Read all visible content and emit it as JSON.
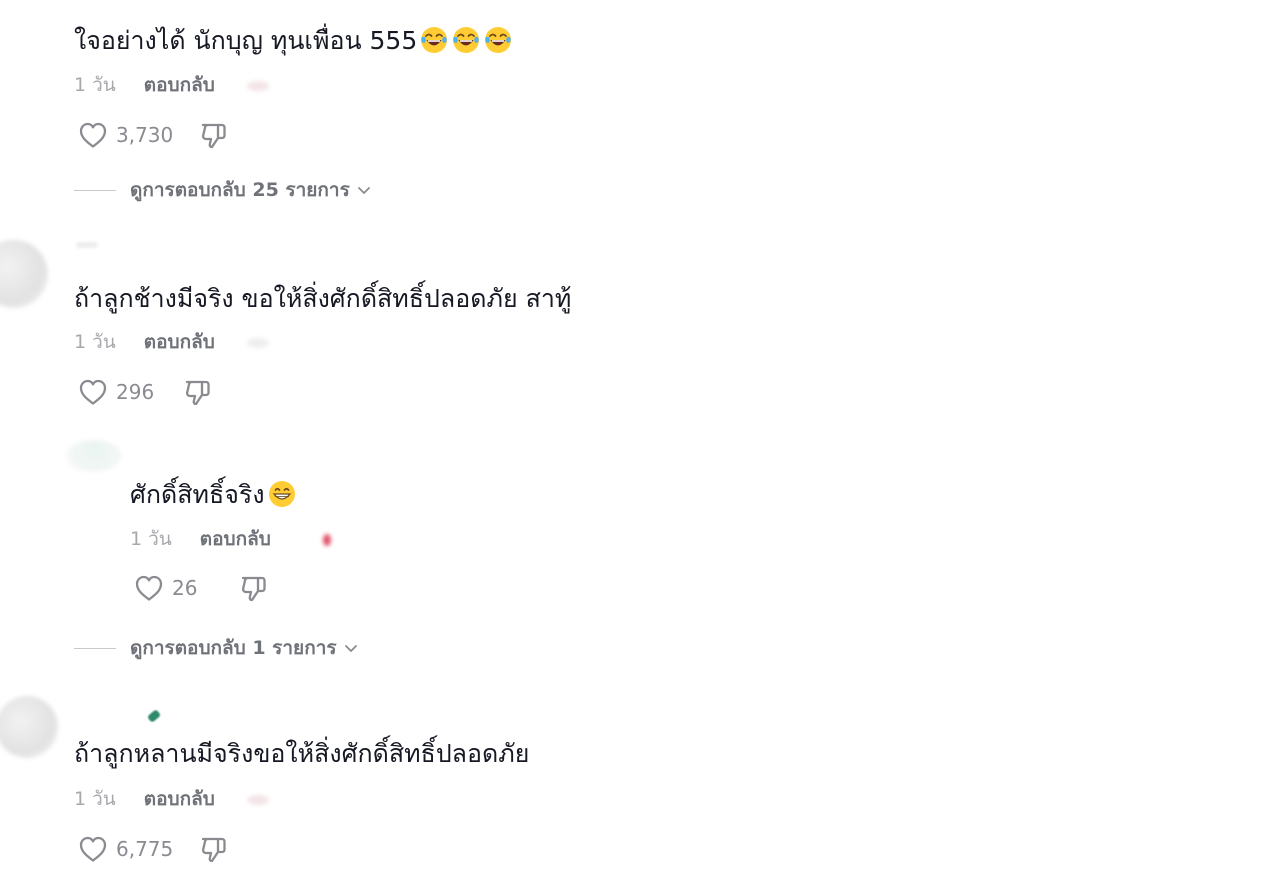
{
  "comments": [
    {
      "text": "ใจอย่างได้ นักบุญ ทุนเพื่อน 555",
      "emoji": [
        "face-with-tears-of-joy",
        "face-with-tears-of-joy",
        "face-with-tears-of-joy"
      ],
      "time": "1 วัน",
      "reply_label": "ตอบกลับ",
      "likes": "3,730",
      "view_replies": "ดูการตอบกลับ 25 รายการ"
    },
    {
      "text": "ถ้าลูกช้างมีจริง ขอให้สิ่งศักดิ์สิทธิ์ปลอดภัย สาทู้",
      "time": "1 วัน",
      "reply_label": "ตอบกลับ",
      "likes": "296"
    },
    {
      "text": "ศักดิ์สิทธิ์จริง",
      "emoji": [
        "grinning-face"
      ],
      "time": "1 วัน",
      "reply_label": "ตอบกลับ",
      "likes": "26",
      "view_replies": "ดูการตอบกลับ 1 รายการ"
    },
    {
      "text": "ถ้าลูกหลานมีจริงขอให้สิ่งศักดิ์สิทธิ์ปลอดภัย",
      "time": "1 วัน",
      "reply_label": "ตอบกลับ",
      "likes": "6,775"
    }
  ],
  "colors": {
    "text": "#161823",
    "meta": "#a6a8ad",
    "reply": "#6f7278",
    "icon": "#8a8b91"
  }
}
